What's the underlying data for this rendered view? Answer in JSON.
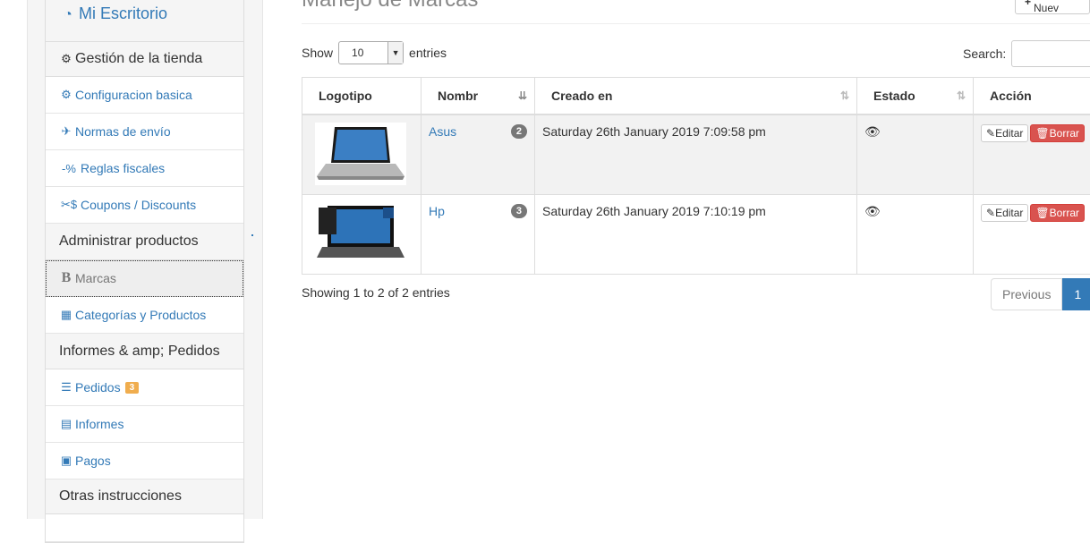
{
  "sidebar": {
    "top": "Mi Escritorio",
    "sections": [
      {
        "title": "Gestión de la tienda",
        "items": [
          {
            "label": "Configuracion basica",
            "icon": "gear-icon"
          },
          {
            "label": "Normas de envío",
            "icon": "plane-icon"
          },
          {
            "label": "Reglas fiscales",
            "icon": "percent-icon"
          },
          {
            "label": "Coupons / Discounts",
            "icon": "scissors-dollar-icon"
          }
        ]
      },
      {
        "title": "Administrar productos",
        "items": [
          {
            "label": "Marcas",
            "icon": "bold-b-icon"
          },
          {
            "label": "Categorías y Productos",
            "icon": "grid-icon"
          }
        ]
      },
      {
        "title": "Informes & amp; Pedidos",
        "items": [
          {
            "label": "Pedidos",
            "icon": "list-icon",
            "badge": "3"
          },
          {
            "label": "Informes",
            "icon": "list-alt-icon"
          },
          {
            "label": "Pagos",
            "icon": "money-icon"
          }
        ]
      },
      {
        "title": "Otras instrucciones",
        "items": []
      }
    ]
  },
  "main": {
    "title": "Manejo de Marcas",
    "create_label": "Crear Nuev",
    "show_label": "Show",
    "show_value": "10",
    "entries_label": "entries",
    "search_label": "Search:",
    "columns": [
      "Logotipo",
      "Nombr",
      "Creado en",
      "Estado",
      "Acción"
    ],
    "rows": [
      {
        "name": "Asus",
        "count": "2",
        "created": "Saturday 26th January 2019 7:09:58 pm",
        "edit": "Editar",
        "delete": "Borrar"
      },
      {
        "name": "Hp",
        "count": "3",
        "created": "Saturday 26th January 2019 7:10:19 pm",
        "edit": "Editar",
        "delete": "Borrar"
      }
    ],
    "info": "Showing 1 to 2 of 2 entries",
    "pager": {
      "prev": "Previous",
      "current": "1"
    }
  }
}
